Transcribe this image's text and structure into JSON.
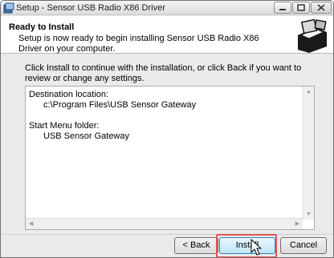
{
  "window": {
    "title": "Setup - Sensor USB Radio X86 Driver"
  },
  "header": {
    "title": "Ready to Install",
    "subtitle": "Setup is now ready to begin installing Sensor USB Radio X86 Driver on your computer."
  },
  "body": {
    "intro": "Click Install to continue with the installation, or click Back if you want to review or change any settings."
  },
  "memo": {
    "destination_label": "Destination location:",
    "destination_value": "c:\\Program Files\\USB Sensor Gateway",
    "start_menu_label": "Start Menu folder:",
    "start_menu_value": "USB Sensor Gateway"
  },
  "buttons": {
    "back": "< Back",
    "install": "Install",
    "cancel": "Cancel"
  },
  "colors": {
    "highlight": "#e05656"
  }
}
